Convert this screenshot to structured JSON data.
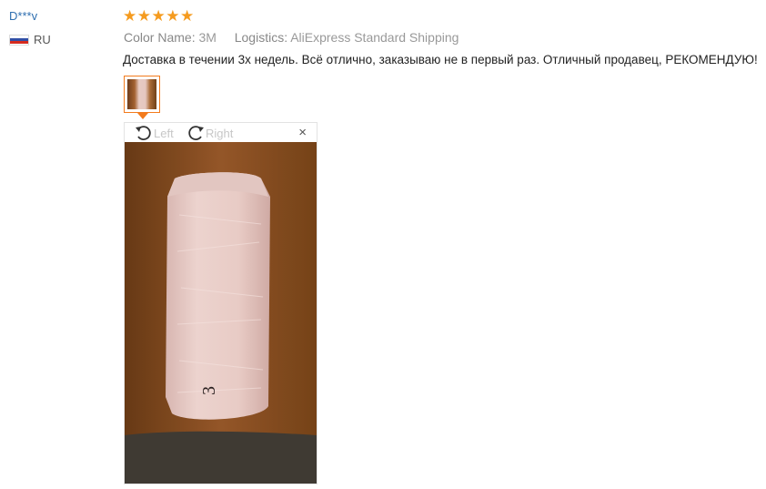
{
  "reviewer": {
    "name": "D***v",
    "country_code": "RU",
    "flag_colors": [
      "#ffffff",
      "#3150a6",
      "#d52b1e"
    ]
  },
  "rating": {
    "stars": 5,
    "max": 5,
    "color": "#f59b1f"
  },
  "meta": {
    "color_label": "Color Name:",
    "color_value": "3M",
    "logistics_label": "Logistics:",
    "logistics_value": "AliExpress Standard Shipping"
  },
  "review": {
    "text": "Доставка в течении 3х недель. Всё отлично, заказываю не в первый раз. Отличный продавец, РЕКОМЕНДУЮ!"
  },
  "viewer": {
    "rotate_left_label": "Left",
    "rotate_right_label": "Right",
    "close_symbol": "×",
    "photo_handwriting": "3"
  },
  "colors": {
    "accent": "#f37b1d",
    "link": "#2f6fb0"
  },
  "icons": [
    "star-icon",
    "rotate-left-icon",
    "rotate-right-icon",
    "close-icon",
    "flag-icon"
  ]
}
